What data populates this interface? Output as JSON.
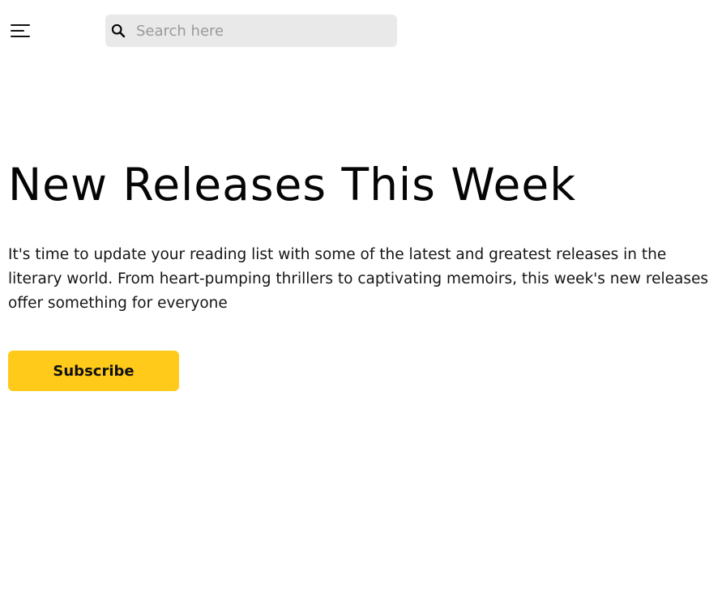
{
  "header": {
    "menu_icon": "hamburger-menu-icon",
    "search": {
      "icon": "search-icon",
      "placeholder": "Search here",
      "value": ""
    }
  },
  "hero": {
    "title": "New Releases This Week",
    "description": "It's time to update your reading list with some of the latest and greatest releases in the literary world. From heart-pumping thrillers to captivating memoirs, this week's new releases offer something for everyone",
    "subscribe_label": "Subscribe"
  },
  "colors": {
    "background": "#ffffff",
    "search_background": "#e9e9e9",
    "subscribe_background": "#ffca1a",
    "text": "#111111"
  }
}
